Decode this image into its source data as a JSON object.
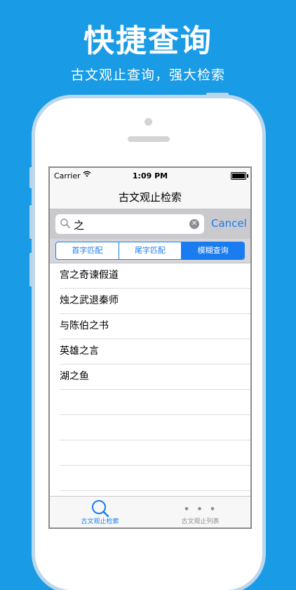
{
  "promo": {
    "headline": "快捷查询",
    "subline": "古文观止查询，强大检索"
  },
  "status_bar": {
    "carrier": "Carrier",
    "time": "1:09 PM",
    "battery_level": 1.0
  },
  "nav": {
    "title": "古文观止检索"
  },
  "search": {
    "value": "之",
    "cancel_label": "Cancel"
  },
  "segments": {
    "items": [
      {
        "label": "首字匹配",
        "selected": false
      },
      {
        "label": "尾字匹配",
        "selected": false
      },
      {
        "label": "模糊查询",
        "selected": true
      }
    ]
  },
  "results": [
    {
      "title": "宫之奇谏假道"
    },
    {
      "title": "烛之武退秦师"
    },
    {
      "title": "与陈伯之书"
    },
    {
      "title": "英雄之言"
    },
    {
      "title": "湖之鱼"
    }
  ],
  "tabs": [
    {
      "label": "古文观止检索",
      "icon": "magnifier-icon",
      "active": true
    },
    {
      "label": "古文观止列表",
      "icon": "more-icon",
      "active": false
    }
  ],
  "colors": {
    "background": "#1a9be6",
    "accent": "#1a7cf0"
  }
}
